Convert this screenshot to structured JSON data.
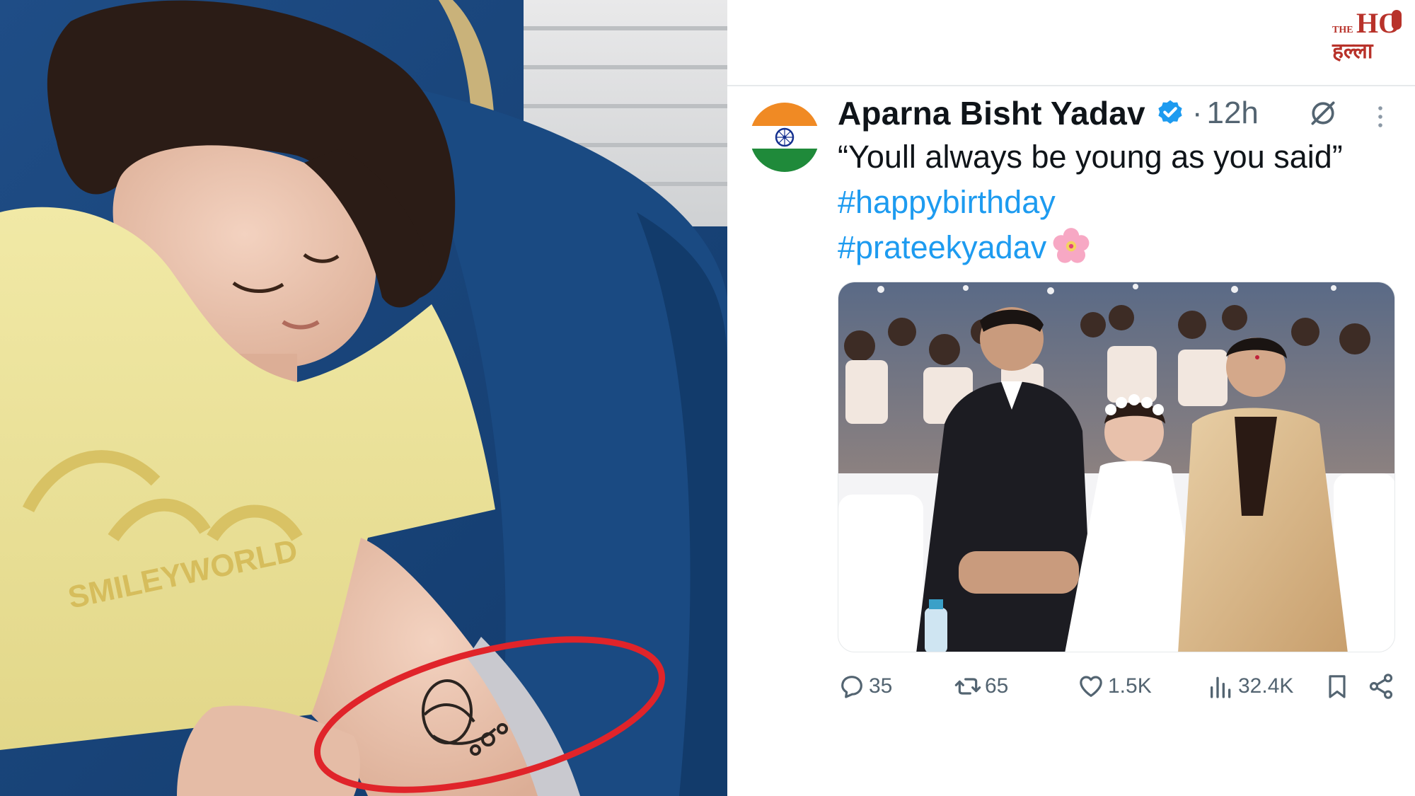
{
  "logo": {
    "text_the": "THE",
    "text_ho": "HO",
    "text_script": "हल्ला"
  },
  "left_photo": {
    "shirt_print": "SMILEYWORLD",
    "highlight_color": "#e0242a"
  },
  "tweet": {
    "author_name": "Aparna Bisht Yadav",
    "separator": "·",
    "time": "12h",
    "text_plain": "“Youll always be young as you said”",
    "hashtag_1": "#happybirthday",
    "hashtag_2": "#prateekyadav",
    "accent_color": "#1d9bf0",
    "actions": {
      "reply": {
        "icon": "reply-icon",
        "count": "35"
      },
      "repost": {
        "icon": "repost-icon",
        "count": "65"
      },
      "like": {
        "icon": "heart-icon",
        "count": "1.5K"
      },
      "views": {
        "icon": "views-icon",
        "count": "32.4K"
      },
      "bookmark": {
        "icon": "bookmark-icon"
      },
      "share": {
        "icon": "share-icon"
      }
    }
  }
}
